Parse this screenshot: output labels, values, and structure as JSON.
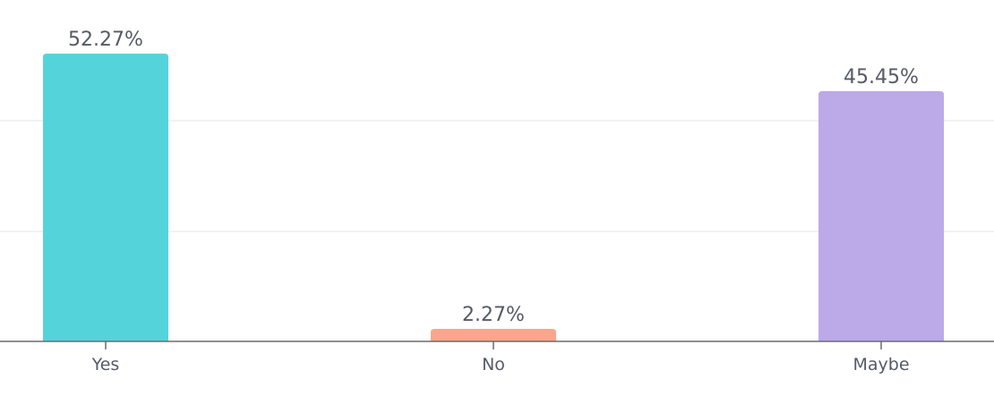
{
  "chart_data": {
    "type": "bar",
    "title": "",
    "xlabel": "",
    "ylabel": "",
    "categories": [
      "Yes",
      "No",
      "Maybe"
    ],
    "values": [
      52.27,
      2.27,
      45.45
    ],
    "value_labels": [
      "52.27%",
      "2.27%",
      "45.45%"
    ],
    "colors": [
      "#54d4da",
      "#f9a68c",
      "#bca9e8"
    ],
    "ylim": [
      0,
      52.27
    ],
    "grid": true,
    "legend": "none"
  }
}
